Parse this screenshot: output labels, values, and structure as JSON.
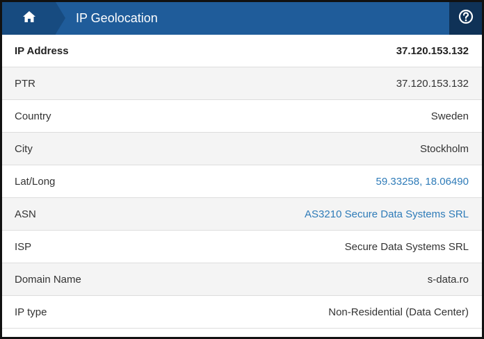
{
  "header": {
    "title": "IP Geolocation",
    "home_icon": "home-icon",
    "help_icon": "question-circle-icon"
  },
  "colors": {
    "header_bg": "#1f5c9a",
    "home_bg": "#174b80",
    "help_bg": "#0f3257",
    "link": "#2e7bb8"
  },
  "rows": [
    {
      "label": "IP Address",
      "value": "37.120.153.132"
    },
    {
      "label": "PTR",
      "value": "37.120.153.132"
    },
    {
      "label": "Country",
      "value": "Sweden"
    },
    {
      "label": "City",
      "value": "Stockholm"
    },
    {
      "label": "Lat/Long",
      "value": "59.33258, 18.06490"
    },
    {
      "label": "ASN",
      "value": "AS3210 Secure Data Systems SRL"
    },
    {
      "label": "ISP",
      "value": "Secure Data Systems SRL"
    },
    {
      "label": "Domain Name",
      "value": "s-data.ro"
    },
    {
      "label": "IP type",
      "value": "Non-Residential (Data Center)"
    }
  ]
}
